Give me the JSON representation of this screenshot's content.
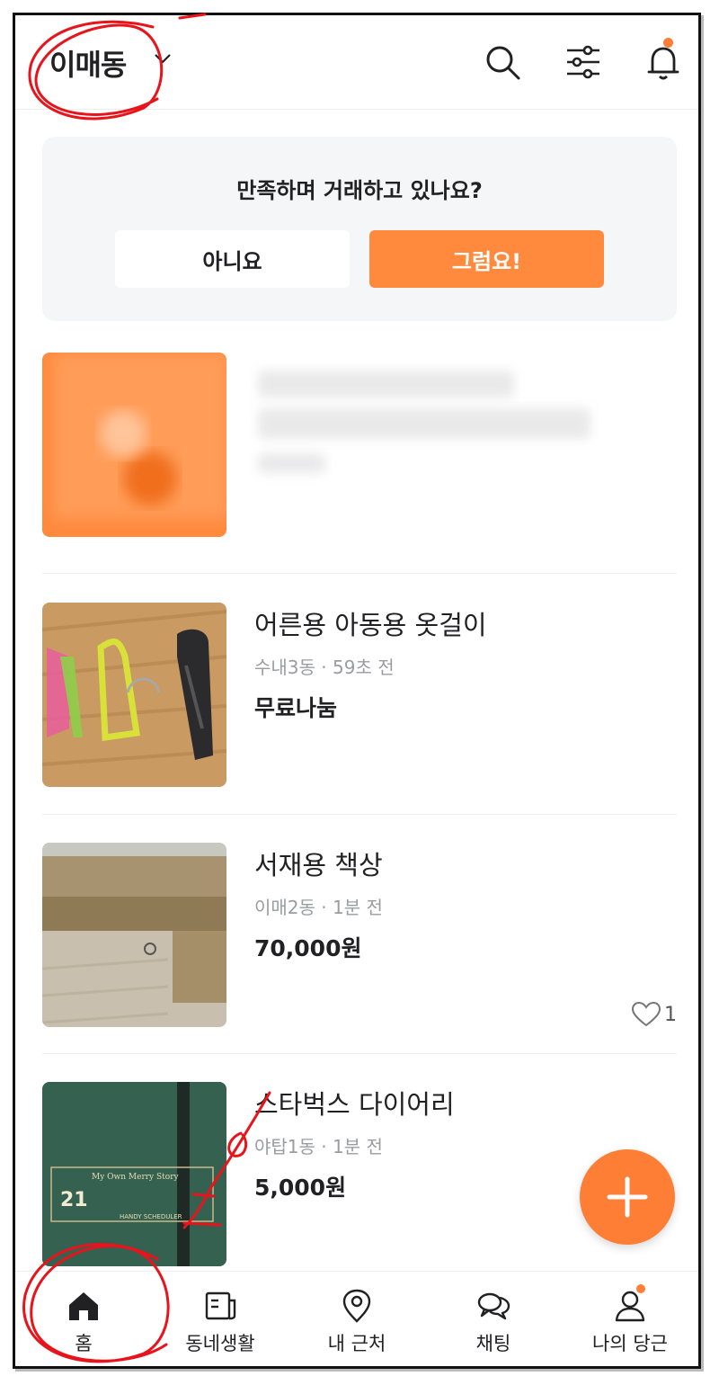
{
  "header": {
    "location_label": "이매동",
    "icons": [
      "chevron-down-icon",
      "search-icon",
      "filter-icon",
      "bell-icon"
    ]
  },
  "survey": {
    "question": "만족하며 거래하고 있나요?",
    "no_label": "아니요",
    "yes_label": "그럼요!"
  },
  "listings": [
    {
      "title": "어른용 아동용 옷걸이",
      "location": "수내3동",
      "time": "59초 전",
      "price": "무료나눔",
      "likes": ""
    },
    {
      "title": "서재용 책상",
      "location": "이매2동",
      "time": "1분 전",
      "price": "70,000원",
      "likes": "1"
    },
    {
      "title": "스타벅스 다이어리",
      "location": "야탑1동",
      "time": "1분 전",
      "price": "5,000원",
      "likes": ""
    }
  ],
  "meta_separator": "·",
  "diary_print": {
    "line1": "My Own Merry Story",
    "number": "21",
    "brand": "HANDY SCHEDULER"
  },
  "fab": {
    "icon": "plus-icon"
  },
  "nav": [
    {
      "label": "홈",
      "icon": "home-icon"
    },
    {
      "label": "동네생활",
      "icon": "neighborhood-icon"
    },
    {
      "label": "내 근처",
      "icon": "location-pin-icon"
    },
    {
      "label": "채팅",
      "icon": "chat-icon"
    },
    {
      "label": "나의 당근",
      "icon": "profile-icon"
    }
  ],
  "colors": {
    "accent": "#ff7e36",
    "annotation": "#e8141c",
    "text": "#212124",
    "muted": "#9a9ca2"
  }
}
